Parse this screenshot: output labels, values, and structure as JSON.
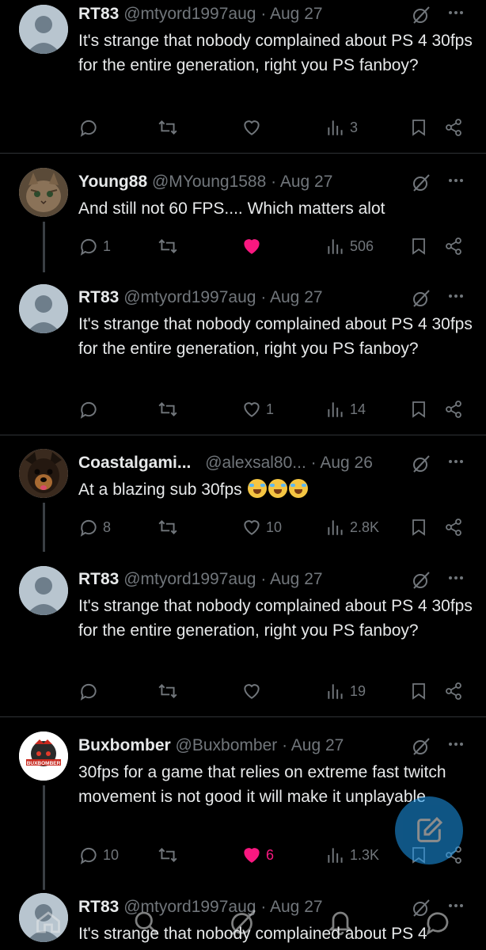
{
  "colors": {
    "background": "#000000",
    "text": "#e7e9ea",
    "muted": "#71767b",
    "like": "#f91880",
    "accent": "#1d9bf0"
  },
  "tweets": [
    {
      "name": "RT83",
      "handle": "@mtyord1997aug",
      "sep": "·",
      "date": "Aug 27",
      "text": "It's strange that nobody complained about PS 4 30fps for the entire generation, right you PS fanboy?",
      "replies": "",
      "likes": "",
      "views": "3",
      "liked": false
    },
    {
      "name": "Young88",
      "handle": "@MYoung1588",
      "sep": "·",
      "date": "Aug 27",
      "text": "And still not 60 FPS.... Which matters alot",
      "replies": "1",
      "likes": "",
      "views": "506",
      "liked": true
    },
    {
      "name": "RT83",
      "handle": "@mtyord1997aug",
      "sep": "·",
      "date": "Aug 27",
      "text": "It's strange that nobody complained about PS 4 30fps for the entire generation, right you PS fanboy?",
      "replies": "",
      "likes": "1",
      "views": "14",
      "liked": false
    },
    {
      "name": "Coastalgami...",
      "handle": "@alexsal80...",
      "sep": "·",
      "date": "Aug 26",
      "text": "At a blazing sub 30fps",
      "replies": "8",
      "likes": "10",
      "views": "2.8K",
      "liked": false
    },
    {
      "name": "RT83",
      "handle": "@mtyord1997aug",
      "sep": "·",
      "date": "Aug 27",
      "text": "It's strange that nobody complained about PS 4 30fps for the entire generation, right you PS fanboy?",
      "replies": "",
      "likes": "",
      "views": "19",
      "liked": false
    },
    {
      "name": "Buxbomber",
      "handle": "@Buxbomber",
      "sep": "·",
      "date": "Aug 27",
      "text": "30fps for a game that relies on extreme fast twitch movement is not good it will make it unplayable",
      "replies": "10",
      "likes": "6",
      "views": "1.3K",
      "liked": true
    },
    {
      "name": "RT83",
      "handle": "@mtyord1997aug",
      "sep": "·",
      "date": "Aug 27",
      "text": "It's strange that nobody complained about PS 4",
      "replies": "",
      "likes": "",
      "views": "",
      "liked": false
    }
  ],
  "avatar_logo_text": "BUXBOMBER",
  "icons": [
    "reply-icon",
    "retweet-icon",
    "like-icon",
    "views-icon",
    "bookmark-icon",
    "share-icon",
    "grok-icon",
    "more-icon",
    "compose-icon",
    "home-icon",
    "search-icon",
    "notifications-icon",
    "messages-icon"
  ]
}
